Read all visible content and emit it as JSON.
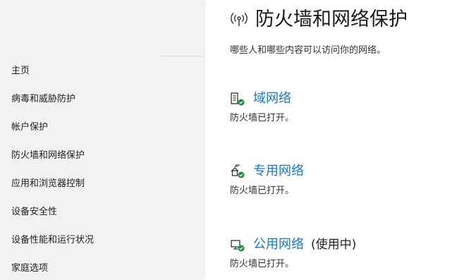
{
  "sidebar": {
    "items": [
      {
        "label": "主页"
      },
      {
        "label": "病毒和威胁防护"
      },
      {
        "label": "帐户保护"
      },
      {
        "label": "防火墙和网络保护"
      },
      {
        "label": "应用和浏览器控制"
      },
      {
        "label": "设备安全性"
      },
      {
        "label": "设备性能和运行状况"
      },
      {
        "label": "家庭选项"
      }
    ]
  },
  "header": {
    "icon": "wireless-antenna-icon",
    "title": "防火墙和网络保护",
    "subtitle": "哪些人和哪些内容可以访问你的网络。"
  },
  "networks": [
    {
      "icon": "domain-network-icon",
      "label": "域网络",
      "suffix": "",
      "status": "防火墙已打开。"
    },
    {
      "icon": "private-network-icon",
      "label": "专用网络",
      "suffix": "",
      "status": "防火墙已打开。"
    },
    {
      "icon": "public-network-icon",
      "label": "公用网络",
      "suffix": "(使用中)",
      "status": "防火墙已打开。"
    }
  ],
  "colors": {
    "link": "#1479c6",
    "ok_badge": "#1e8a3a",
    "sidebar_bg": "#f2f2f2"
  }
}
